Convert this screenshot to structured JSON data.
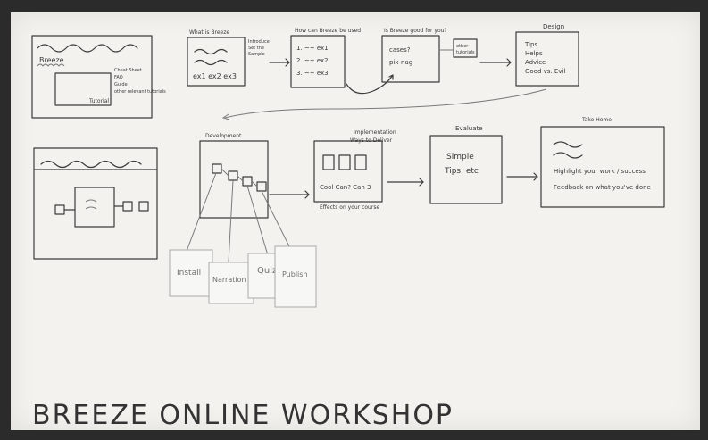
{
  "board": {
    "title": "BREEZE ONLINE WORKSHOP"
  },
  "sketch_top_left": {
    "left_labels": [
      "Breeze"
    ],
    "right_notes": [
      "Cheat Sheet",
      "FAQ",
      "Guide",
      "other relevant tutorials"
    ],
    "inner_label": "Tutorial"
  },
  "steps": [
    {
      "id": "what-is-breeze",
      "header": "What is Breeze",
      "side_note": [
        "Introduce",
        "Set the",
        "Sample"
      ],
      "body": [
        "ex1  ex2  ex3"
      ]
    },
    {
      "id": "how-can-breeze-be-used",
      "header": "How can Breeze be used",
      "body": [
        "1. ~~ ex1",
        "2. ~~ ex2",
        "3. ~~ ex3"
      ]
    },
    {
      "id": "questions",
      "header": "Is Breeze good for you?",
      "body": [
        "cases?",
        "pix-nag"
      ],
      "aside": [
        "other",
        "tutorials"
      ]
    },
    {
      "id": "design",
      "header": "Design",
      "body": [
        "Tips",
        "Helps",
        "Advice",
        "Good vs. Evil"
      ]
    },
    {
      "id": "development",
      "header": "Development",
      "body": []
    },
    {
      "id": "implementation",
      "header": "Implementation",
      "subheader": "Ways to Deliver",
      "body": [
        "Cool Can? Can 3"
      ],
      "footer": "Effects on your course"
    },
    {
      "id": "evaluate",
      "header": "Evaluate",
      "body": [
        "Simple",
        "Tips, etc"
      ]
    },
    {
      "id": "take-home",
      "header": "Take Home",
      "body": [
        "Highlight your work / success",
        "Feedback on what you've done"
      ]
    }
  ],
  "cards": [
    "Install",
    "Narration",
    "Quiz",
    "Publish"
  ],
  "colors": {
    "board": "#f3f2ee",
    "frame": "#2b2b2b",
    "ink": "#3c3c3c"
  }
}
